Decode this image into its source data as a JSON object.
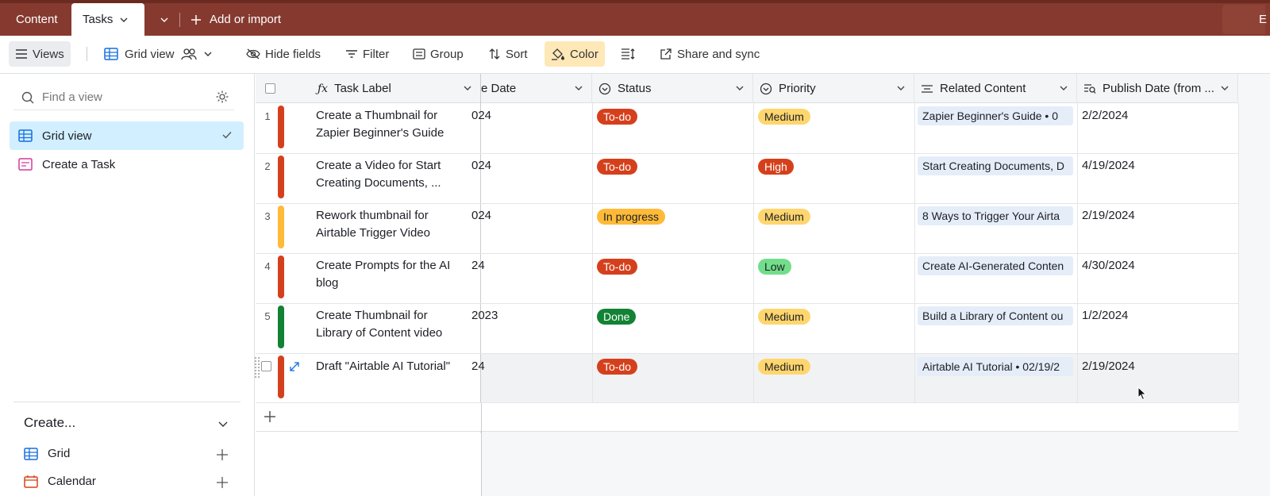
{
  "tabs": {
    "content": "Content",
    "tasks": "Tasks",
    "add_import": "Add or import",
    "right_partial": "E"
  },
  "toolbar": {
    "views": "Views",
    "grid_view": "Grid view",
    "hide_fields": "Hide fields",
    "filter": "Filter",
    "group": "Group",
    "sort": "Sort",
    "color": "Color",
    "share_sync": "Share and sync"
  },
  "sidebar": {
    "find_placeholder": "Find a view",
    "views": [
      {
        "label": "Grid view",
        "selected": true
      },
      {
        "label": "Create a Task",
        "selected": false
      }
    ],
    "create_heading": "Create...",
    "create_items": [
      {
        "label": "Grid"
      },
      {
        "label": "Calendar"
      }
    ]
  },
  "columns": {
    "task_label": "Task Label",
    "due_date": "e Date",
    "status": "Status",
    "priority": "Priority",
    "related": "Related Content",
    "publish": "Publish Date (from ..."
  },
  "colors": {
    "todo": "#d5401c",
    "in_progress": "#ffba38",
    "done": "#128234",
    "medium": "#ffd66e",
    "high": "#d5401c",
    "low": "#72dd8a"
  },
  "rows": [
    {
      "num": "1",
      "task1": "Create a Thumbnail for",
      "task2": "Zapier Beginner's Guide",
      "date": "024",
      "status": "To-do",
      "priority": "Medium",
      "related": "Zapier Beginner's Guide • 0",
      "publish": "2/2/2024",
      "bar": "#d5401c"
    },
    {
      "num": "2",
      "task1": "Create a Video for Start",
      "task2": "Creating Documents, ...",
      "date": "024",
      "status": "To-do",
      "priority": "High",
      "related": "Start Creating Documents, D",
      "publish": "4/19/2024",
      "bar": "#d5401c"
    },
    {
      "num": "3",
      "task1": "Rework thumbnail for",
      "task2": "Airtable Trigger Video",
      "date": "024",
      "status": "In progress",
      "priority": "Medium",
      "related": "8 Ways to Trigger Your Airta",
      "publish": "2/19/2024",
      "bar": "#ffba38"
    },
    {
      "num": "4",
      "task1": "Create Prompts for the AI",
      "task2": "blog",
      "date": "24",
      "status": "To-do",
      "priority": "Low",
      "related": "Create AI-Generated Conten",
      "publish": "4/30/2024",
      "bar": "#d5401c"
    },
    {
      "num": "5",
      "task1": "Create Thumbnail for",
      "task2": "Library of Content video",
      "date": "2023",
      "status": "Done",
      "priority": "Medium",
      "related": "Build a Library of Content ou",
      "publish": "1/2/2024",
      "bar": "#128234"
    },
    {
      "num": "",
      "task1": "Draft \"Airtable AI Tutorial\"",
      "task2": "",
      "date": "24",
      "status": "To-do",
      "priority": "Medium",
      "related": "Airtable AI Tutorial • 02/19/2",
      "publish": "2/19/2024",
      "bar": "#d5401c"
    }
  ]
}
